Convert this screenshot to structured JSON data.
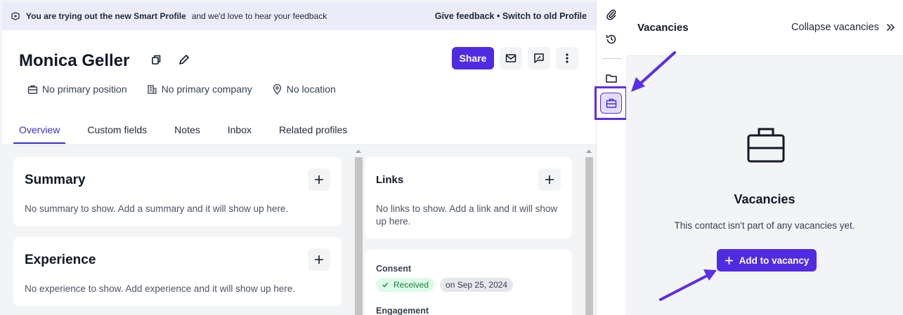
{
  "banner": {
    "lead": "You are trying out the new Smart Profile",
    "rest": "and we'd love to hear your feedback",
    "feedback_link": "Give feedback",
    "separator": "•",
    "switch_link": "Switch to old Profile"
  },
  "profile": {
    "name": "Monica Geller",
    "position": "No primary position",
    "company": "No primary company",
    "location": "No location",
    "share_label": "Share"
  },
  "tabs": [
    {
      "label": "Overview",
      "active": true
    },
    {
      "label": "Custom fields"
    },
    {
      "label": "Notes"
    },
    {
      "label": "Inbox"
    },
    {
      "label": "Related profiles"
    }
  ],
  "cards": {
    "summary": {
      "title": "Summary",
      "empty": "No summary to show. Add a summary and it will show up here."
    },
    "experience": {
      "title": "Experience",
      "empty": "No experience to show. Add experience and it will show up here."
    },
    "links": {
      "title": "Links",
      "empty": "No links to show. Add a link and it will show up here."
    },
    "consent": {
      "title": "Consent",
      "status": "Received",
      "date": "on Sep 25, 2024"
    },
    "engagement": {
      "title": "Engagement"
    }
  },
  "vacancies": {
    "header_title": "Vacancies",
    "collapse_label": "Collapse vacancies",
    "empty_title": "Vacancies",
    "empty_subtitle": "This contact isn't part of any vacancies yet.",
    "add_label": "Add to vacancy"
  },
  "colors": {
    "accent": "#4f2be2",
    "annotation": "#5b2ee8",
    "consent_bg": "#dcfce7",
    "consent_text": "#15803d"
  },
  "icons": {
    "strip": [
      "paperclip-icon",
      "history-icon",
      "folder-icon",
      "briefcase-icon"
    ]
  }
}
